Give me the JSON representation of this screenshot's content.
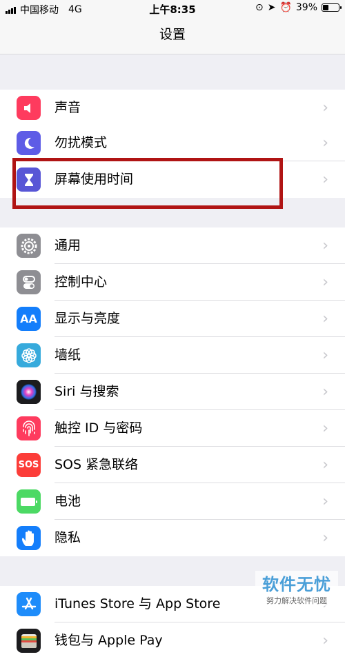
{
  "status_bar": {
    "carrier": "中国移动",
    "network": "4G",
    "time": "上午8:35",
    "battery": "39%",
    "battery_level": 0.39
  },
  "nav": {
    "title": "设置"
  },
  "rows": [
    {
      "label": "声音",
      "icon": "speaker-icon",
      "color": "#fe3b5e"
    },
    {
      "label": "勿扰模式",
      "icon": "moon-icon",
      "color": "#5e5ce6"
    },
    {
      "label": "屏幕使用时间",
      "icon": "hourglass-icon",
      "color": "#5856d6"
    },
    {
      "label": "通用",
      "icon": "gear-icon",
      "color": "#8e8e93"
    },
    {
      "label": "控制中心",
      "icon": "toggles-icon",
      "color": "#8e8e93"
    },
    {
      "label": "显示与亮度",
      "icon": "text-size-icon",
      "color": "#147efb",
      "icon_text": "AA"
    },
    {
      "label": "墙纸",
      "icon": "flower-icon",
      "color": "#36aadc"
    },
    {
      "label": "Siri 与搜索",
      "icon": "siri-icon",
      "color": "#1c1c1e"
    },
    {
      "label": "触控 ID 与密码",
      "icon": "fingerprint-icon",
      "color": "#fe3b5e"
    },
    {
      "label": "SOS 紧急联络",
      "icon": "sos-icon",
      "color": "#fc3d39",
      "icon_text": "SOS"
    },
    {
      "label": "电池",
      "icon": "battery-icon",
      "color": "#4cd964"
    },
    {
      "label": "隐私",
      "icon": "hand-icon",
      "color": "#147efb"
    },
    {
      "label": "iTunes Store 与 App Store",
      "icon": "app-store-icon",
      "color": "#1e8cfa"
    },
    {
      "label": "钱包与 Apple Pay",
      "icon": "wallet-icon",
      "color": "#1c1c1e"
    }
  ],
  "watermark": {
    "main": "软件无忧",
    "sub": "努力解决软件问题"
  },
  "highlight_color": "#b01414"
}
